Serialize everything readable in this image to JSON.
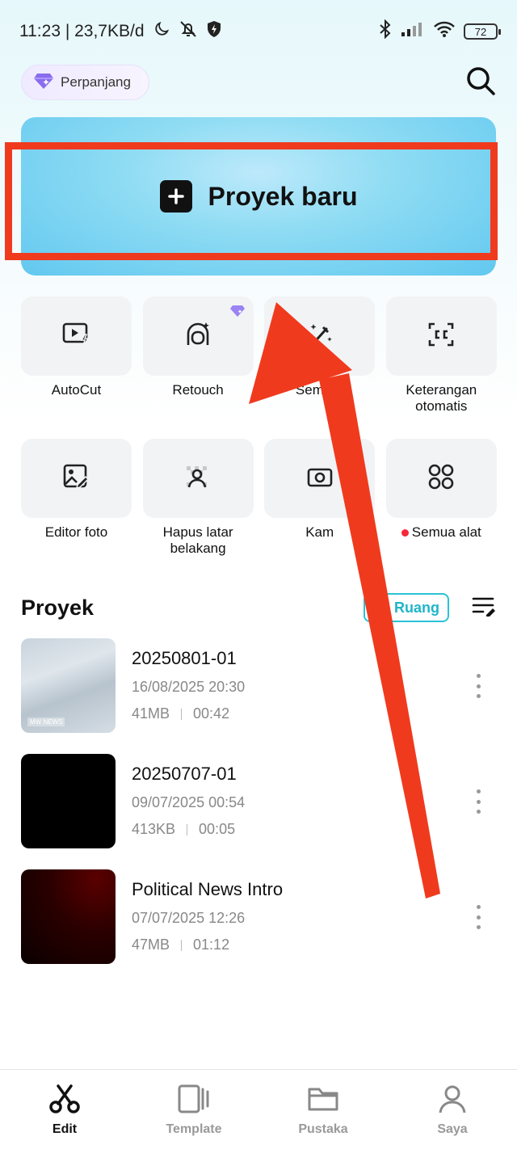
{
  "status_bar": {
    "time_speed": "11:23 | 23,7KB/d",
    "battery": "72"
  },
  "header": {
    "premium_label": "Perpanjang"
  },
  "new_project": {
    "label": "Proyek baru"
  },
  "tools": [
    {
      "label": "AutoCut",
      "icon": "play-bolt-icon"
    },
    {
      "label": "Retouch",
      "icon": "retouch-icon",
      "premium": true
    },
    {
      "label": "Sempur",
      "icon": "magic-wand-icon"
    },
    {
      "label": "Keterangan otomatis",
      "icon": "captions-icon"
    },
    {
      "label": "Editor foto",
      "icon": "photo-edit-icon"
    },
    {
      "label": "Hapus latar belakang",
      "icon": "remove-bg-icon"
    },
    {
      "label": "Kam",
      "icon": "camera-icon"
    },
    {
      "label": "Semua alat",
      "icon": "grid-icon",
      "dot": true
    }
  ],
  "projects": {
    "title": "Proyek",
    "space_button": "Ruang",
    "items": [
      {
        "name": "20250801-01",
        "date": "16/08/2025 20:30",
        "size": "41MB",
        "duration": "00:42"
      },
      {
        "name": "20250707-01",
        "date": "09/07/2025 00:54",
        "size": "413KB",
        "duration": "00:05"
      },
      {
        "name": "Political News Intro",
        "date": "07/07/2025 12:26",
        "size": "47MB",
        "duration": "01:12"
      }
    ],
    "thumb_logo": "MW NEWS"
  },
  "bottom_nav": [
    {
      "label": "Edit",
      "active": true
    },
    {
      "label": "Template",
      "active": false
    },
    {
      "label": "Pustaka",
      "active": false
    },
    {
      "label": "Saya",
      "active": false
    }
  ],
  "colors": {
    "highlight": "#f03a1e",
    "accent_cyan": "#2bc2d6",
    "premium_purple": "#8a6cf0"
  }
}
